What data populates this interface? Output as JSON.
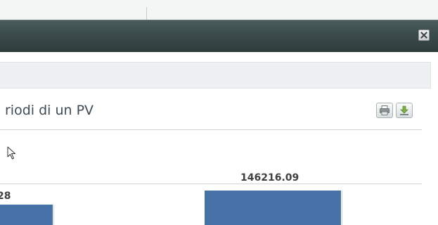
{
  "modal": {
    "close_label": "✕"
  },
  "chart": {
    "title": "riodi di un PV"
  },
  "actions": {
    "print_icon": "printer-icon",
    "download_icon": "download-icon"
  },
  "chart_data": {
    "type": "bar",
    "title": "riodi di un PV",
    "data_labels": [
      "28",
      "146216.09"
    ],
    "values": [
      null,
      146216.09
    ]
  },
  "colors": {
    "title_bar": "#3b4b4b",
    "bar_fill": "#4672a8",
    "title_text": "#3f4b55"
  }
}
